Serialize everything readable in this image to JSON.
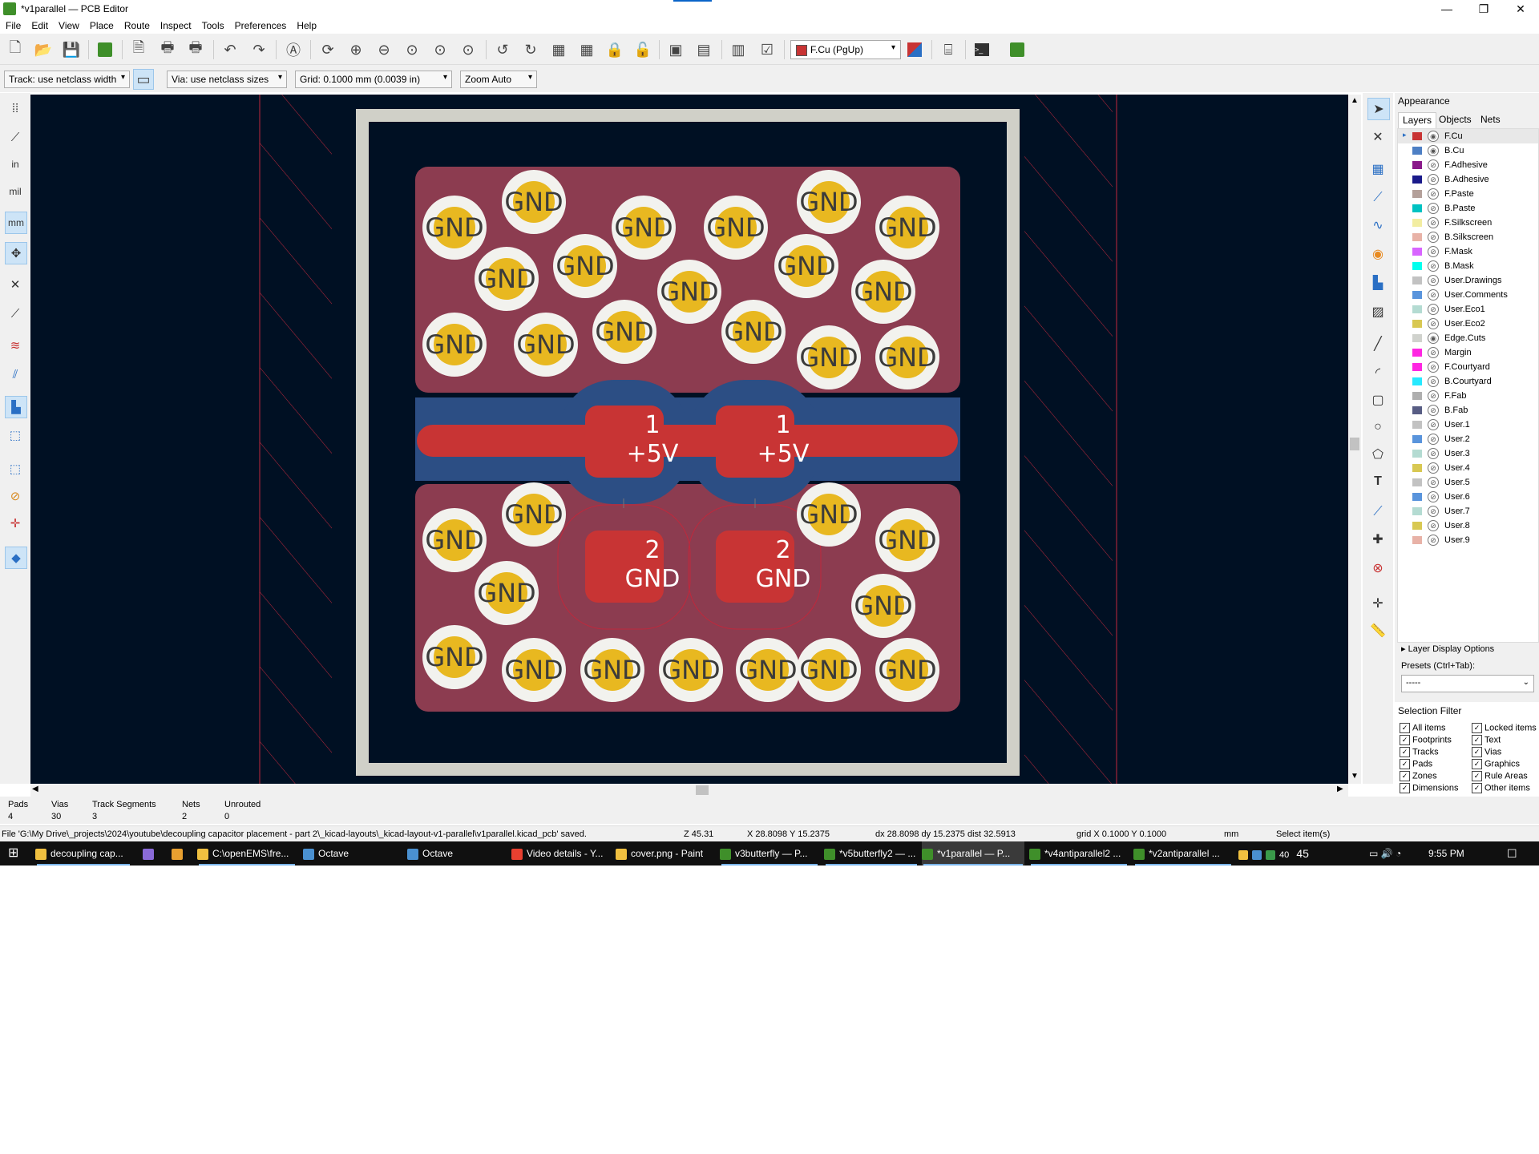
{
  "window": {
    "title": "*v1parallel — PCB Editor",
    "controls": [
      "—",
      "❐",
      "✕"
    ]
  },
  "menu": [
    "File",
    "Edit",
    "View",
    "Place",
    "Route",
    "Inspect",
    "Tools",
    "Preferences",
    "Help"
  ],
  "toolbar": {
    "active_layer": "F.Cu (PgUp)",
    "active_layer_color": "#c83434"
  },
  "options": {
    "track_width": "Track: use netclass width",
    "via_size": "Via: use netclass sizes",
    "grid": "Grid: 0.1000 mm (0.0039 in)",
    "zoom": "Zoom Auto"
  },
  "left_toolbar": {
    "units_in": "in",
    "units_mil": "mil",
    "units_mm": "mm"
  },
  "pcb": {
    "via_label": "GND",
    "pads": [
      {
        "number": "1",
        "net": "+5V"
      },
      {
        "number": "1",
        "net": "+5V"
      },
      {
        "number": "2",
        "net": "GND"
      },
      {
        "number": "2",
        "net": "GND"
      }
    ],
    "colors": {
      "background": "#001023",
      "edge_cuts": "#d0d0c8",
      "zone": "#8c3c50",
      "back_copper": "#2c4e84",
      "front_copper": "#c83434",
      "via_ring": "#f2f2ee",
      "via_hole": "#e8b820",
      "courtyard": "#c0283c"
    }
  },
  "appearance": {
    "title": "Appearance",
    "tabs": [
      "Layers",
      "Objects",
      "Nets"
    ],
    "layers": [
      {
        "name": "F.Cu",
        "color": "#c83434",
        "visible": true
      },
      {
        "name": "B.Cu",
        "color": "#4d7fc4",
        "visible": true
      },
      {
        "name": "F.Adhesive",
        "color": "#8a1a8a",
        "visible": false
      },
      {
        "name": "B.Adhesive",
        "color": "#1a1a8a",
        "visible": false
      },
      {
        "name": "F.Paste",
        "color": "#b4a09a",
        "visible": false
      },
      {
        "name": "B.Paste",
        "color": "#00c2c2",
        "visible": false
      },
      {
        "name": "F.Silkscreen",
        "color": "#f2eda1",
        "visible": false
      },
      {
        "name": "B.Silkscreen",
        "color": "#e8b2a7",
        "visible": false
      },
      {
        "name": "F.Mask",
        "color": "#d864ff",
        "visible": false
      },
      {
        "name": "B.Mask",
        "color": "#02ffee",
        "visible": false
      },
      {
        "name": "User.Drawings",
        "color": "#c2c2c2",
        "visible": false
      },
      {
        "name": "User.Comments",
        "color": "#5994dc",
        "visible": false
      },
      {
        "name": "User.Eco1",
        "color": "#b4dbd2",
        "visible": false
      },
      {
        "name": "User.Eco2",
        "color": "#d8c852",
        "visible": false
      },
      {
        "name": "Edge.Cuts",
        "color": "#d0d2cd",
        "visible": true
      },
      {
        "name": "Margin",
        "color": "#ff26e2",
        "visible": false
      },
      {
        "name": "F.Courtyard",
        "color": "#ff26e2",
        "visible": false
      },
      {
        "name": "B.Courtyard",
        "color": "#26e9ff",
        "visible": false
      },
      {
        "name": "F.Fab",
        "color": "#afafaf",
        "visible": false
      },
      {
        "name": "B.Fab",
        "color": "#585d84",
        "visible": false
      },
      {
        "name": "User.1",
        "color": "#c2c2c2",
        "visible": false
      },
      {
        "name": "User.2",
        "color": "#5994dc",
        "visible": false
      },
      {
        "name": "User.3",
        "color": "#b4dbd2",
        "visible": false
      },
      {
        "name": "User.4",
        "color": "#d8c852",
        "visible": false
      },
      {
        "name": "User.5",
        "color": "#c2c2c2",
        "visible": false
      },
      {
        "name": "User.6",
        "color": "#5994dc",
        "visible": false
      },
      {
        "name": "User.7",
        "color": "#b4dbd2",
        "visible": false
      },
      {
        "name": "User.8",
        "color": "#d8c852",
        "visible": false
      },
      {
        "name": "User.9",
        "color": "#e8b2a7",
        "visible": false
      }
    ],
    "layer_display_options": "Layer Display Options",
    "presets_label": "Presets (Ctrl+Tab):",
    "presets_value": "-----"
  },
  "selection_filter": {
    "title": "Selection Filter",
    "items": [
      "All items",
      "Locked items",
      "Footprints",
      "Text",
      "Tracks",
      "Vias",
      "Pads",
      "Graphics",
      "Zones",
      "Rule Areas",
      "Dimensions",
      "Other items"
    ]
  },
  "message_panel": [
    {
      "label": "Pads",
      "value": "4"
    },
    {
      "label": "Vias",
      "value": "30"
    },
    {
      "label": "Track Segments",
      "value": "3"
    },
    {
      "label": "Nets",
      "value": "2"
    },
    {
      "label": "Unrouted",
      "value": "0"
    }
  ],
  "status": {
    "message": "File 'G:\\My Drive\\_projects\\2024\\youtube\\decoupling capacitor placement - part 2\\_kicad-layouts\\_kicad-layout-v1-parallel\\v1parallel.kicad_pcb' saved.",
    "zoom": "Z 45.31",
    "cursor": "X 28.8098  Y 15.2375",
    "delta": "dx 28.8098  dy 15.2375  dist 32.5913",
    "grid": "grid X 0.1000  Y 0.1000",
    "units": "mm",
    "mode": "Select item(s)"
  },
  "taskbar": {
    "items": [
      {
        "label": "decoupling cap...",
        "color": "#f0c040"
      },
      {
        "label": "",
        "color": "#8a6ad8"
      },
      {
        "label": "",
        "color": "#e8a030"
      },
      {
        "label": "C:\\openEMS\\fre...",
        "color": "#f0c040"
      },
      {
        "label": "Octave",
        "color": "#4a90d0"
      },
      {
        "label": "Octave",
        "color": "#4a90d0"
      },
      {
        "label": "Video details - Y...",
        "color": "#e84030"
      },
      {
        "label": "cover.png - Paint",
        "color": "#f0c040"
      },
      {
        "label": "v3butterfly — P...",
        "color": "#3f8f2a"
      },
      {
        "label": "*v5butterfly2 — ...",
        "color": "#3f8f2a"
      },
      {
        "label": "*v1parallel — P...",
        "color": "#3f8f2a"
      },
      {
        "label": "*v4antiparallel2 ...",
        "color": "#3f8f2a"
      },
      {
        "label": "*v2antiparallel ...",
        "color": "#3f8f2a"
      }
    ],
    "tray_number": "40",
    "tray_count": "45",
    "time": "9:55 PM"
  }
}
